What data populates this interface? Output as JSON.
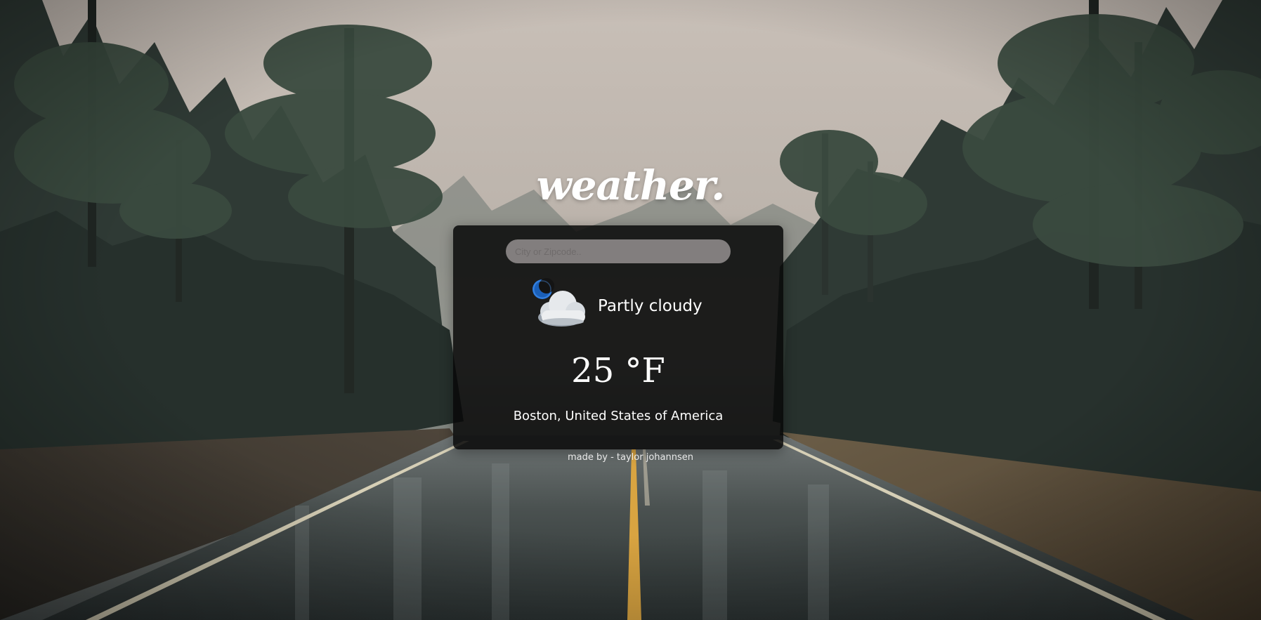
{
  "app": {
    "logo_text": "weather."
  },
  "search": {
    "placeholder": "City or Zipcode..",
    "value": ""
  },
  "weather": {
    "icon": "moon-cloud-icon",
    "condition": "Partly cloudy",
    "temperature": "25 °F",
    "location": "Boston, United States of America"
  },
  "footer": {
    "credit": "made by - taylor johannsen"
  },
  "colors": {
    "card_background": "#080808",
    "search_background": "#aaa5a5",
    "text": "#ffffff",
    "moon": "#1f6fd1"
  },
  "background": {
    "description_icon": "rainy-forest-road-photo"
  }
}
